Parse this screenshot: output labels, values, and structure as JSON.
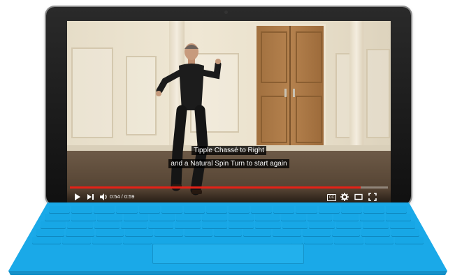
{
  "video": {
    "subtitle_line1": "Tipple Chassé to Right",
    "subtitle_line2": "and a Natural Spin Turn to start again",
    "current_time": "0:54",
    "duration": "0:59",
    "time_display": "0:54 / 0:59",
    "progress_fraction": 0.915
  },
  "controls": {
    "play_icon": "play-icon",
    "next_icon": "next-icon",
    "volume_icon": "volume-icon",
    "cc_label": "CC",
    "settings_icon": "gear-icon",
    "theater_icon": "theater-mode-icon",
    "fullscreen_icon": "fullscreen-icon"
  },
  "colors": {
    "progress": "#e62117",
    "keyboard": "#1aa9e8",
    "bezel": "#111111"
  }
}
